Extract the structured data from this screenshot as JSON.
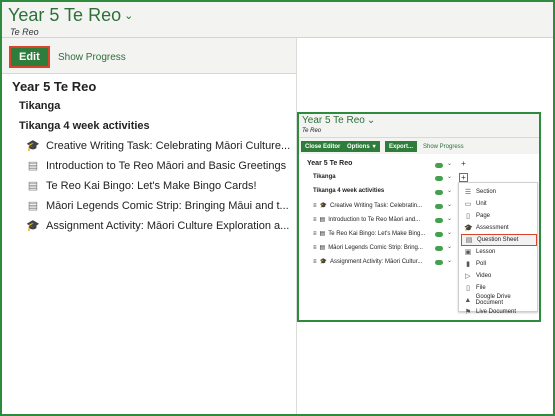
{
  "header": {
    "course_title": "Year 5 Te Reo",
    "subtitle": "Te Reo"
  },
  "toolbar": {
    "edit_label": "Edit",
    "show_progress": "Show Progress"
  },
  "tree": {
    "root": "Year 5 Te Reo",
    "section": "Tikanga",
    "subsection": "Tikanga 4 week activities",
    "items": [
      {
        "label": "Creative Writing Task: Celebrating Māori Culture...",
        "icon": "graduation-cap-icon"
      },
      {
        "label": "Introduction to Te Reo Māori and Basic Greetings",
        "icon": "slides-icon"
      },
      {
        "label": "Te Reo Kai Bingo: Let's Make Bingo Cards!",
        "icon": "slides-icon"
      },
      {
        "label": "Māori Legends Comic Strip: Bringing Māui and t...",
        "icon": "slides-icon"
      },
      {
        "label": "Assignment Activity: Māori Culture Exploration a...",
        "icon": "graduation-cap-icon"
      }
    ]
  },
  "inset": {
    "course_title": "Year 5 Te Reo",
    "subtitle": "Te Reo",
    "buttons": {
      "close_editor": "Close Editor",
      "options": "Options",
      "export": "Export...",
      "show_progress": "Show Progress"
    },
    "tree": {
      "root": "Year 5 Te Reo",
      "section": "Tikanga",
      "subsection": "Tikanga 4 week activities",
      "items": [
        "Creative Writing Task: Celebratin...",
        "Introduction to Te Reo Māori and...",
        "Te Reo Kai Bingo: Let's Make Bing...",
        "Māori Legends Comic Strip: Bring...",
        "Assignment Activity: Māori Cultur..."
      ]
    },
    "add_menu": [
      {
        "label": "Section",
        "icon": "section-icon"
      },
      {
        "label": "Unit",
        "icon": "unit-icon"
      },
      {
        "label": "Page",
        "icon": "page-icon"
      },
      {
        "label": "Assessment",
        "icon": "assessment-icon"
      },
      {
        "label": "Question Sheet",
        "icon": "question-sheet-icon",
        "selected": true
      },
      {
        "label": "Lesson",
        "icon": "lesson-icon"
      },
      {
        "label": "Poll",
        "icon": "poll-icon"
      },
      {
        "label": "Video",
        "icon": "video-icon"
      },
      {
        "label": "File",
        "icon": "file-icon"
      },
      {
        "label": "Google Drive Document",
        "icon": "google-drive-icon"
      },
      {
        "label": "Live Document",
        "icon": "live-document-icon"
      }
    ]
  },
  "colors": {
    "brand_green": "#2f7d3a",
    "highlight_red": "#d9452b",
    "toggle_green": "#45a04e"
  }
}
